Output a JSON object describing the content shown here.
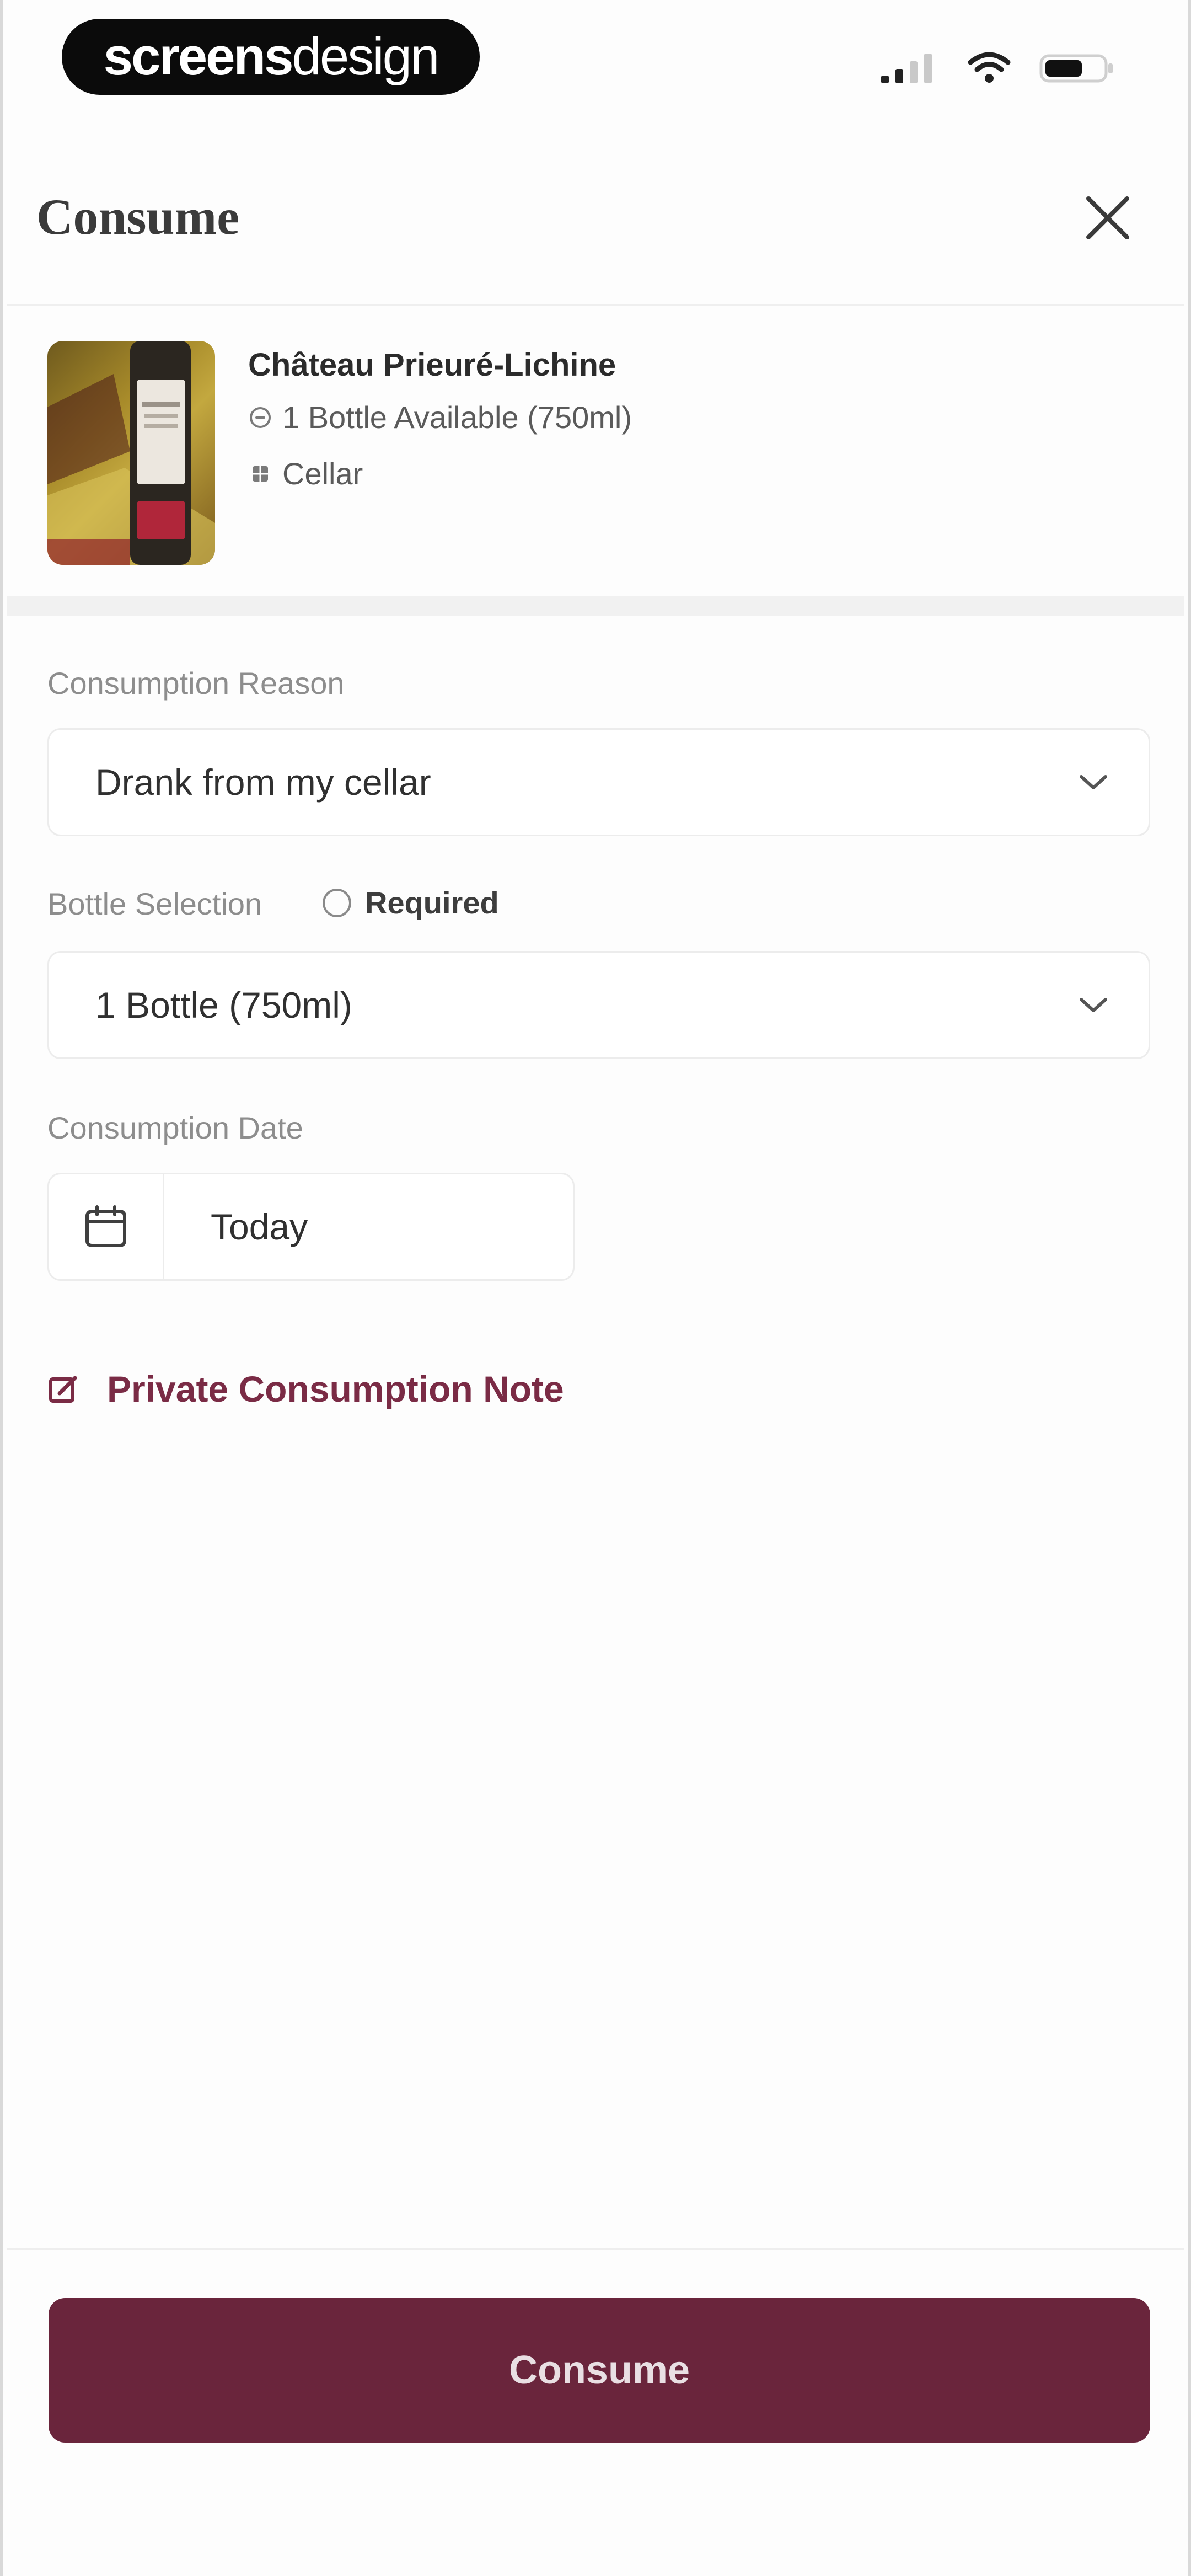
{
  "status_bar": {
    "brand_bold": "screens",
    "brand_light": "design"
  },
  "header": {
    "title": "Consume",
    "close_icon": "close-icon"
  },
  "wine": {
    "name": "Château Prieuré-Lichine",
    "availability": "1 Bottle Available (750ml)",
    "location": "Cellar"
  },
  "form": {
    "reason_label": "Consumption Reason",
    "reason_value": "Drank from my cellar",
    "bottle_label": "Bottle Selection",
    "bottle_required": "Required",
    "bottle_value": "1 Bottle (750ml)",
    "date_label": "Consumption Date",
    "date_value": "Today",
    "note_link": "Private Consumption Note"
  },
  "footer": {
    "submit_label": "Consume"
  },
  "colors": {
    "accent": "#6a253c",
    "note_link": "#7a2b45"
  }
}
